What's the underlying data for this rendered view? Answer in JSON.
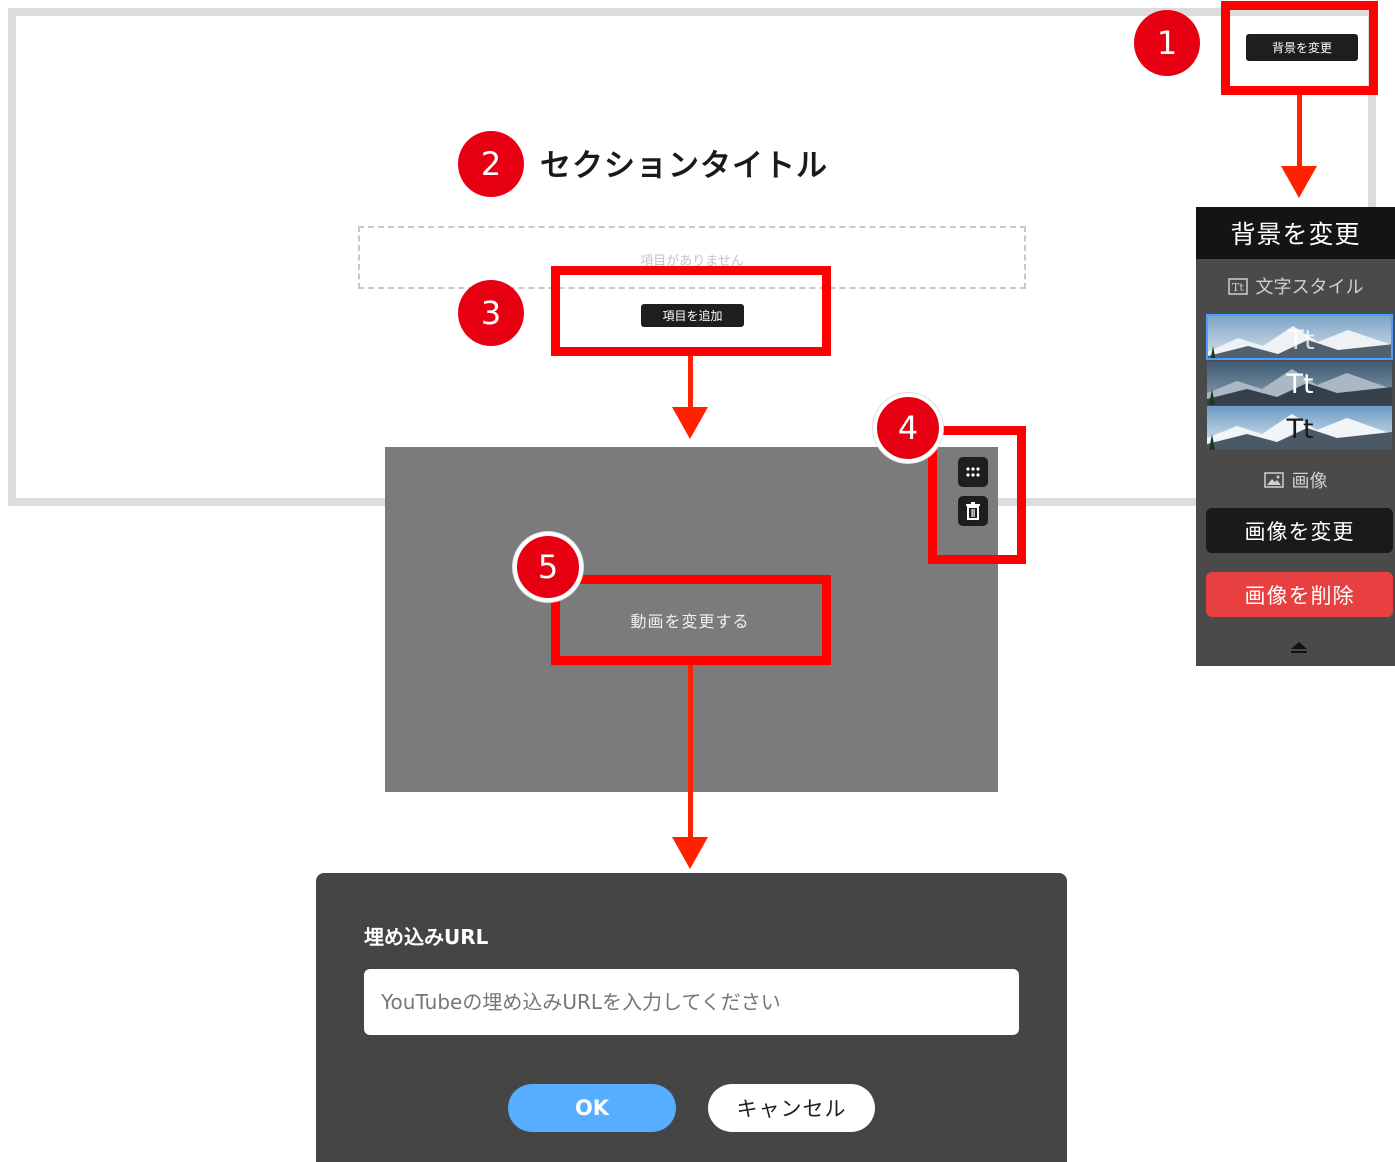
{
  "badges": [
    "1",
    "2",
    "3",
    "4",
    "5"
  ],
  "top_button": {
    "label": "背景を変更"
  },
  "section": {
    "title": "セクションタイトル",
    "empty_text": "項目がありません",
    "add_item_label": "項目を追加"
  },
  "video": {
    "change_label": "動画を変更する"
  },
  "panel": {
    "header": "背景を変更",
    "text_style_label": "文字スタイル",
    "thumb_text": "Tt",
    "image_label": "画像",
    "change_image_label": "画像を変更",
    "delete_image_label": "画像を削除"
  },
  "dialog": {
    "title": "埋め込みURL",
    "input_placeholder": "YouTubeの埋め込みURLを入力してください",
    "ok_label": "OK",
    "cancel_label": "キャンセル"
  },
  "colors": {
    "badge": "#e60012",
    "highlight": "#ff0000",
    "arrow": "#ff2200",
    "ok_button": "#55aeff",
    "delete_button": "#e84040",
    "selected_thumb_border": "#4a9fff"
  },
  "icons": {
    "drag": "dots-grid-icon",
    "delete": "trash-icon",
    "text_style": "text-style-icon",
    "image": "image-icon",
    "collapse": "eject-icon"
  }
}
